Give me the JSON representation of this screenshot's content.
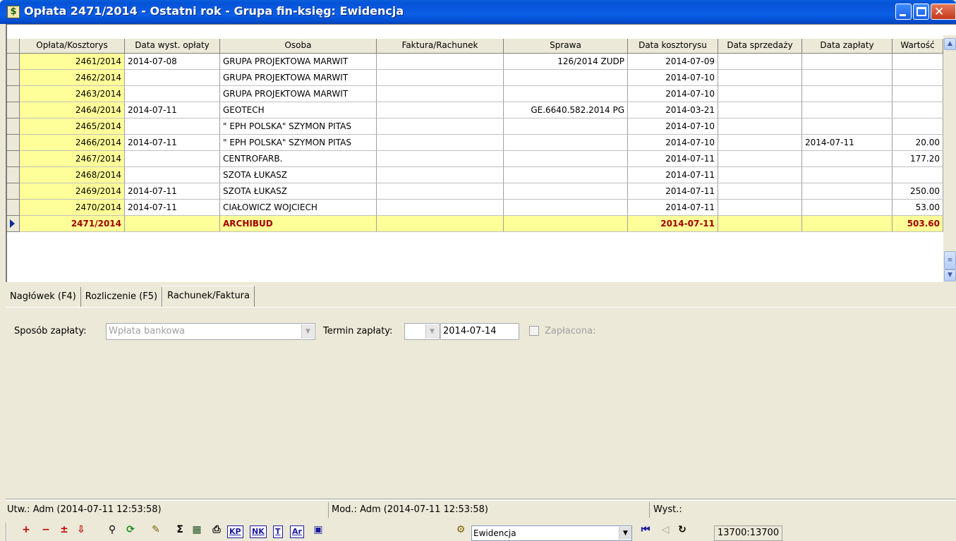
{
  "window": {
    "title": "Opłata 2471/2014 - Ostatni rok - Grupa fin-księg: Ewidencja",
    "app_icon": "$"
  },
  "grid": {
    "columns": [
      "Opłata/Kosztorys",
      "Data wyst. opłaty",
      "Osoba",
      "Faktura/Rachunek",
      "Sprawa",
      "Data kosztorysu",
      "Data sprzedaży",
      "Data zapłaty",
      "Wartość"
    ],
    "rows": [
      {
        "op": "2461/2014",
        "dw": "2014-07-08",
        "os": "GRUPA PROJEKTOWA MARWIT",
        "fr": "",
        "sp": "126/2014 ZUDP",
        "dk": "2014-07-09",
        "ds": "",
        "dz": "",
        "wa": ""
      },
      {
        "op": "2462/2014",
        "dw": "",
        "os": "GRUPA PROJEKTOWA MARWIT",
        "fr": "",
        "sp": "",
        "dk": "2014-07-10",
        "ds": "",
        "dz": "",
        "wa": ""
      },
      {
        "op": "2463/2014",
        "dw": "",
        "os": "GRUPA PROJEKTOWA MARWIT",
        "fr": "",
        "sp": "",
        "dk": "2014-07-10",
        "ds": "",
        "dz": "",
        "wa": ""
      },
      {
        "op": "2464/2014",
        "dw": "2014-07-11",
        "os": "GEOTECH",
        "fr": "",
        "sp": "GE.6640.582.2014 PG",
        "dk": "2014-03-21",
        "ds": "",
        "dz": "",
        "wa": ""
      },
      {
        "op": "2465/2014",
        "dw": "",
        "os": "\" EPH POLSKA\" SZYMON PITAS",
        "fr": "",
        "sp": "",
        "dk": "2014-07-10",
        "ds": "",
        "dz": "",
        "wa": ""
      },
      {
        "op": "2466/2014",
        "dw": "2014-07-11",
        "os": "\" EPH POLSKA\" SZYMON PITAS",
        "fr": "",
        "sp": "",
        "dk": "2014-07-10",
        "ds": "",
        "dz": "2014-07-11",
        "wa": "20.00"
      },
      {
        "op": "2467/2014",
        "dw": "",
        "os": "CENTROFARB.",
        "fr": "",
        "sp": "",
        "dk": "2014-07-11",
        "ds": "",
        "dz": "",
        "wa": "177.20"
      },
      {
        "op": "2468/2014",
        "dw": "",
        "os": "SZOTA ŁUKASZ",
        "fr": "",
        "sp": "",
        "dk": "2014-07-11",
        "ds": "",
        "dz": "",
        "wa": ""
      },
      {
        "op": "2469/2014",
        "dw": "2014-07-11",
        "os": "SZOTA ŁUKASZ",
        "fr": "",
        "sp": "",
        "dk": "2014-07-11",
        "ds": "",
        "dz": "",
        "wa": "250.00"
      },
      {
        "op": "2470/2014",
        "dw": "2014-07-11",
        "os": "CIAŁOWICZ WOJCIECH",
        "fr": "",
        "sp": "",
        "dk": "2014-07-11",
        "ds": "",
        "dz": "",
        "wa": "53.00"
      },
      {
        "op": "2471/2014",
        "dw": "",
        "os": "ARCHIBUD",
        "fr": "",
        "sp": "",
        "dk": "2014-07-11",
        "ds": "",
        "dz": "",
        "wa": "503.60"
      }
    ]
  },
  "tabs": [
    "Nagłówek (F4)",
    "Rozliczenie (F5)",
    "Rachunek/Faktura"
  ],
  "form": {
    "payment_method_label": "Sposób zapłaty:",
    "payment_method_value": "Wpłata bankowa",
    "due_label": "Termin zapłaty:",
    "due_value": "2014-07-14",
    "paid_label": "Zapłacona:"
  },
  "status": {
    "created": "Utw.: Adm (2014-07-11 12:53:58)",
    "modified": "Mod.: Adm (2014-07-11 12:53:58)",
    "issued": "Wyst.:"
  },
  "toolbar": {
    "kp": "KP",
    "nk": "NK",
    "t": "T",
    "ar": "Ar",
    "mode_value": "Ewidencja",
    "counter": "13700:13700"
  },
  "colors": {
    "titlebar": "#0453d6",
    "key_cell": "#ffff99",
    "current_text": "#a00000"
  }
}
